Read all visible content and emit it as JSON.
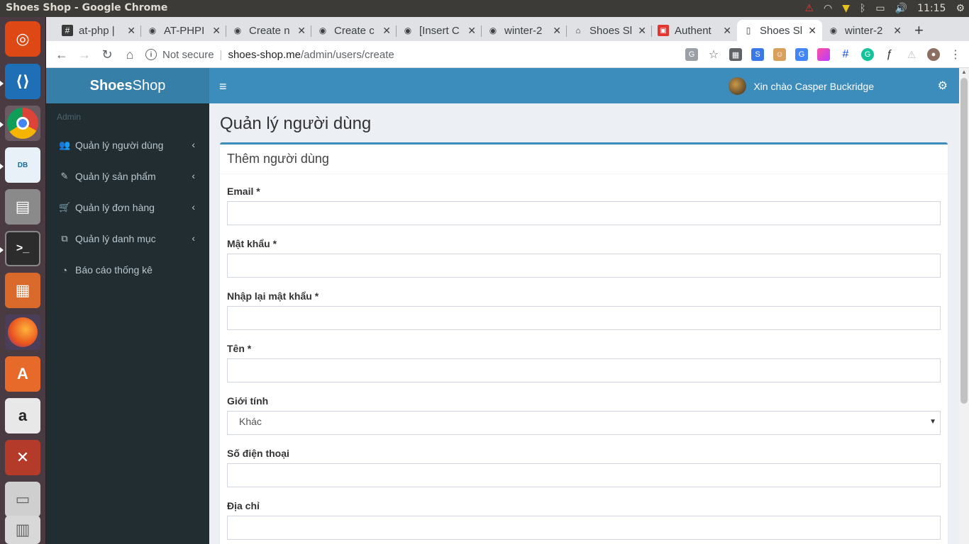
{
  "os": {
    "window_title": "Shoes Shop - Google Chrome",
    "time": "11:15"
  },
  "launcher": {
    "apps": [
      "ubuntu-dash",
      "vscode",
      "chrome",
      "mysql-workbench",
      "files",
      "terminal",
      "impress",
      "firefox",
      "software-center",
      "amazon",
      "system-settings",
      "disk",
      "trash"
    ]
  },
  "tabs": [
    {
      "label": "at-php |",
      "icon": "hash-icon",
      "active": false
    },
    {
      "label": "AT-PHPI",
      "icon": "github-icon",
      "active": false
    },
    {
      "label": "Create n",
      "icon": "github-icon",
      "active": false
    },
    {
      "label": "Create c",
      "icon": "github-icon",
      "active": false
    },
    {
      "label": "[Insert C",
      "icon": "github-icon",
      "active": false
    },
    {
      "label": "winter-2",
      "icon": "github-icon",
      "active": false
    },
    {
      "label": "Shoes Sl",
      "icon": "home-icon",
      "active": false
    },
    {
      "label": "Authent",
      "icon": "laravel-icon",
      "active": false
    },
    {
      "label": "Shoes Sl",
      "icon": "page-icon",
      "active": true
    },
    {
      "label": "winter-2",
      "icon": "github-icon",
      "active": false
    }
  ],
  "omnibox": {
    "security": "Not secure",
    "host": "shoes-shop.me",
    "path": "/admin/users/create"
  },
  "brand": {
    "bold": "Shoes",
    "rest": "Shop"
  },
  "header": {
    "greeting": "Xin chào Casper Buckridge"
  },
  "sidebar": {
    "header": "Admin",
    "items": [
      {
        "label": "Quản lý người dùng",
        "icon": "users-icon",
        "has_children": true
      },
      {
        "label": "Quản lý sản phẩm",
        "icon": "edit-icon",
        "has_children": true
      },
      {
        "label": "Quản lý đơn hàng",
        "icon": "cart-icon",
        "has_children": true
      },
      {
        "label": "Quản lý danh mục",
        "icon": "copy-icon",
        "has_children": true
      },
      {
        "label": "Báo cáo thống kê",
        "icon": "dashboard-icon",
        "has_children": false
      }
    ]
  },
  "main": {
    "page_title": "Quản lý người dùng",
    "box_title": "Thêm người dùng",
    "fields": {
      "email": {
        "label": "Email *",
        "value": ""
      },
      "password": {
        "label": "Mật khẩu *",
        "value": ""
      },
      "password_confirm": {
        "label": "Nhập lại mật khẩu *",
        "value": ""
      },
      "name": {
        "label": "Tên *",
        "value": ""
      },
      "gender": {
        "label": "Giới tính",
        "value": "Khác"
      },
      "phone": {
        "label": "Số điện thoại",
        "value": ""
      },
      "address": {
        "label": "Địa chỉ",
        "value": ""
      }
    }
  },
  "colors": {
    "header_blue": "#3c8dbc",
    "brand_blue": "#367fa9",
    "sidebar_dark": "#222d32",
    "content_bg": "#ecf0f5"
  }
}
